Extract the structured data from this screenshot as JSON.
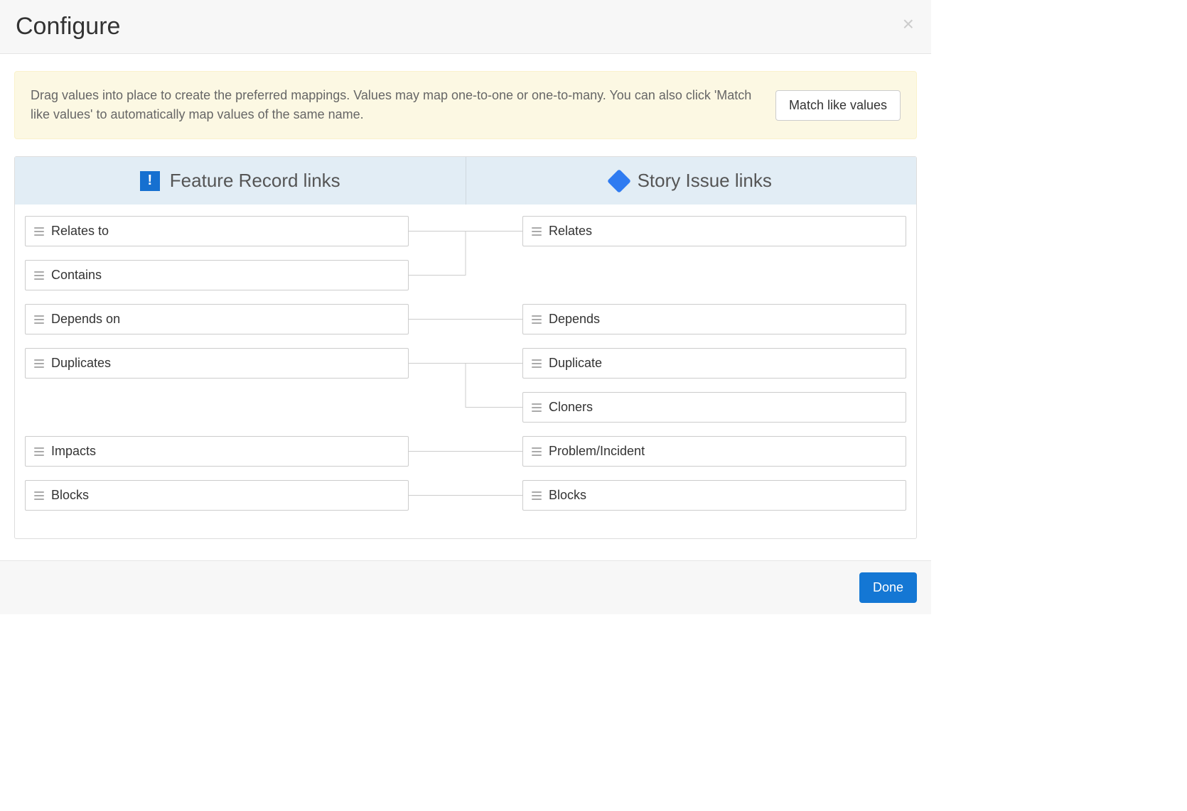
{
  "header": {
    "title": "Configure"
  },
  "alert": {
    "text": "Drag values into place to create the preferred mappings. Values may map one-to-one or one-to-many. You can also click 'Match like values' to automatically map values of the same name.",
    "button": "Match like values"
  },
  "columns": {
    "left_title": "Feature Record links",
    "right_title": "Story Issue links"
  },
  "rows": {
    "left": [
      "Relates to",
      "Contains",
      "Depends on",
      "Duplicates",
      "",
      "Impacts",
      "Blocks"
    ],
    "right": [
      "Relates",
      "",
      "Depends",
      "Duplicate",
      "Cloners",
      "Problem/Incident",
      "Blocks"
    ]
  },
  "connectors": [
    {
      "from": 0,
      "to": 0
    },
    {
      "from": 1,
      "to": 0
    },
    {
      "from": 2,
      "to": 2
    },
    {
      "from": 3,
      "to": 3
    },
    {
      "from": 3,
      "to": 4
    },
    {
      "from": 5,
      "to": 5
    },
    {
      "from": 6,
      "to": 6
    }
  ],
  "footer": {
    "done": "Done"
  }
}
